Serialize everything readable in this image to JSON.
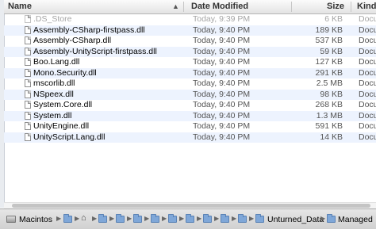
{
  "columns": {
    "name": "Name",
    "date_modified": "Date Modified",
    "size": "Size",
    "kind": "Kind"
  },
  "files": [
    {
      "name": ".DS_Store",
      "date": "Today, 9:39 PM",
      "size": "6 KB",
      "kind": "Docu",
      "dim": true
    },
    {
      "name": "Assembly-CSharp-firstpass.dll",
      "date": "Today, 9:40 PM",
      "size": "189 KB",
      "kind": "Docu",
      "dim": false
    },
    {
      "name": "Assembly-CSharp.dll",
      "date": "Today, 9:40 PM",
      "size": "537 KB",
      "kind": "Docu",
      "dim": false
    },
    {
      "name": "Assembly-UnityScript-firstpass.dll",
      "date": "Today, 9:40 PM",
      "size": "59 KB",
      "kind": "Docu",
      "dim": false
    },
    {
      "name": "Boo.Lang.dll",
      "date": "Today, 9:40 PM",
      "size": "127 KB",
      "kind": "Docu",
      "dim": false
    },
    {
      "name": "Mono.Security.dll",
      "date": "Today, 9:40 PM",
      "size": "291 KB",
      "kind": "Docu",
      "dim": false
    },
    {
      "name": "mscorlib.dll",
      "date": "Today, 9:40 PM",
      "size": "2.5 MB",
      "kind": "Docu",
      "dim": false
    },
    {
      "name": "NSpeex.dll",
      "date": "Today, 9:40 PM",
      "size": "98 KB",
      "kind": "Docu",
      "dim": false
    },
    {
      "name": "System.Core.dll",
      "date": "Today, 9:40 PM",
      "size": "268 KB",
      "kind": "Docu",
      "dim": false
    },
    {
      "name": "System.dll",
      "date": "Today, 9:40 PM",
      "size": "1.3 MB",
      "kind": "Docu",
      "dim": false
    },
    {
      "name": "UnityEngine.dll",
      "date": "Today, 9:40 PM",
      "size": "591 KB",
      "kind": "Docu",
      "dim": false
    },
    {
      "name": "UnityScript.Lang.dll",
      "date": "Today, 9:40 PM",
      "size": "14 KB",
      "kind": "Docu",
      "dim": false
    }
  ],
  "pathbar": {
    "disk_label": "Macintos",
    "unturned_data": "Unturned_Data",
    "managed": "Managed"
  },
  "icons": {
    "sort": "chevron-up-icon",
    "file": "document-icon",
    "folder": "folder-icon",
    "disk": "hard-disk-icon",
    "home": "home-icon",
    "separator": "path-arrow-icon"
  }
}
